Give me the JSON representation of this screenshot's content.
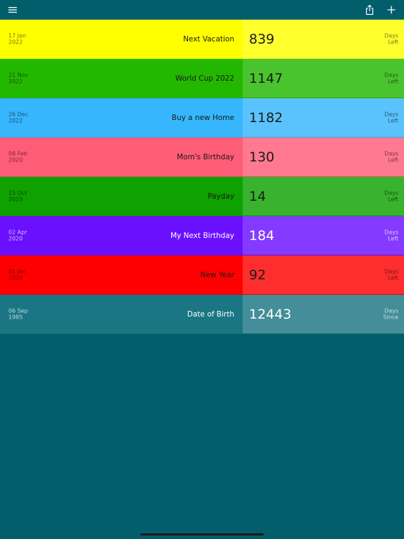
{
  "toolbar": {
    "menu_icon": "hamburger-menu-icon",
    "share_icon": "share-icon",
    "add_icon": "plus-icon"
  },
  "events": [
    {
      "date_line1": "17 Jan",
      "date_line2": "2022",
      "title": "Next Vacation",
      "count": "839",
      "unit_line1": "Days",
      "unit_line2": "Left",
      "color": "#ffff00",
      "text": "dark"
    },
    {
      "date_line1": "21 Nov",
      "date_line2": "2022",
      "title": "World Cup 2022",
      "count": "1147",
      "unit_line1": "Days",
      "unit_line2": "Left",
      "color": "#23b800",
      "text": "dark"
    },
    {
      "date_line1": "26 Dec",
      "date_line2": "2022",
      "title": "Buy a new Home",
      "count": "1182",
      "unit_line1": "Days",
      "unit_line2": "Left",
      "color": "#36b6fd",
      "text": "dark"
    },
    {
      "date_line1": "08 Feb",
      "date_line2": "2020",
      "title": "Mom's Birthday",
      "count": "130",
      "unit_line1": "Days",
      "unit_line2": "Left",
      "color": "#ff5c78",
      "text": "dark"
    },
    {
      "date_line1": "15 Oct",
      "date_line2": "2019",
      "title": "Payday",
      "count": "14",
      "unit_line1": "Days",
      "unit_line2": "Left",
      "color": "#0ea100",
      "text": "dark"
    },
    {
      "date_line1": "02 Apr",
      "date_line2": "2020",
      "title": "My Next Birthday",
      "count": "184",
      "unit_line1": "Days",
      "unit_line2": "Left",
      "color": "#6a10ff",
      "text": "light"
    },
    {
      "date_line1": "01 Jan",
      "date_line2": "2020",
      "title": "New Year",
      "count": "92",
      "unit_line1": "Days",
      "unit_line2": "Left",
      "color": "#ff0000",
      "text": "dark"
    },
    {
      "date_line1": "06 Sep",
      "date_line2": "1985",
      "title": "Date of Birth",
      "count": "12443",
      "unit_line1": "Days",
      "unit_line2": "Since",
      "color": "#1a7682",
      "text": "light"
    }
  ],
  "colors": {
    "background": "#035e6c",
    "icon": "#ffffff"
  }
}
